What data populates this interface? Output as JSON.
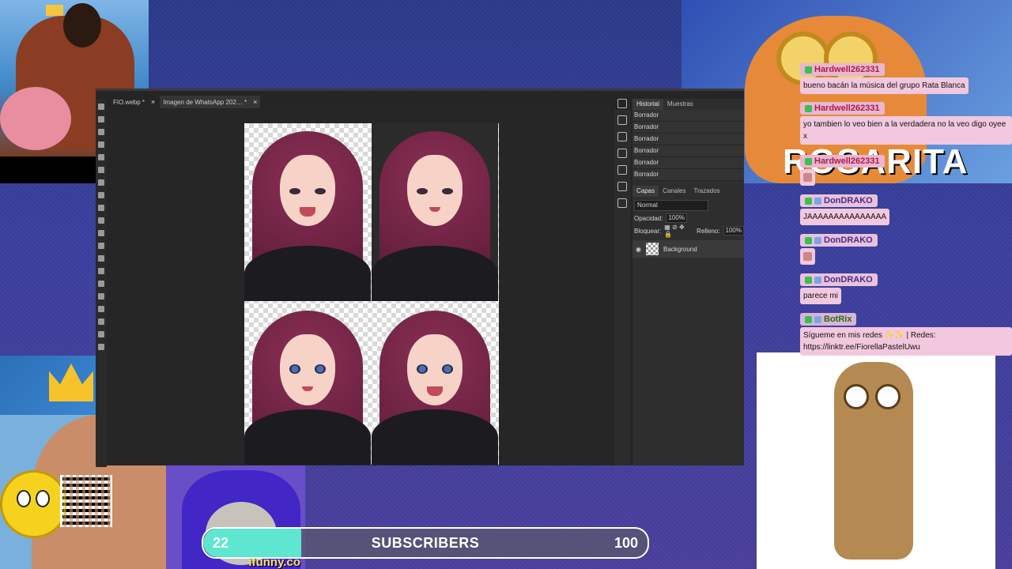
{
  "photoshop": {
    "tabs": [
      {
        "label": "FIO.webp *",
        "close": "×"
      },
      {
        "label": "Imagen de WhatsApp 202… *",
        "close": "×"
      }
    ],
    "panels": {
      "top_tabs": [
        "Historial",
        "Muestras"
      ],
      "history_items": [
        "Borrador",
        "Borrador",
        "Borrador",
        "Borrador",
        "Borrador",
        "Borrador"
      ],
      "layer_tabs": [
        "Capas",
        "Canales",
        "Trazados"
      ],
      "blend_mode": "Normal",
      "opacity_label": "Opacidad:",
      "opacity_value": "100%",
      "lock_label": "Bloquear:",
      "fill_label": "Relleno:",
      "fill_value": "100%",
      "layer_name": "Background"
    }
  },
  "chat": [
    {
      "user": "Hardwell262331",
      "message": "bueno bacán la música del grupo Rata Blanca"
    },
    {
      "user": "Hardwell262331",
      "message": "yo tambien lo veo bien a la verdadera no la veo digo oyee x"
    },
    {
      "user": "Hardwell262331",
      "message": ""
    },
    {
      "user": "DonDRAKO",
      "message": "JAAAAAAAAAAAAAAA"
    },
    {
      "user": "DonDRAKO",
      "message": ""
    },
    {
      "user": "DonDRAKO",
      "message": "parece mi"
    },
    {
      "user": "BotRix",
      "message": "Sígueme en mis redes ✨✨ | Redes: https://linktr.ee/FiorellaPastelUwu"
    }
  ],
  "overlays": {
    "top_right_watermark": "ROSARITA",
    "bottom_watermark": "ifunny.co"
  },
  "subscriber_goal": {
    "current": "22",
    "label": "SUBSCRIBERS",
    "goal": "100",
    "progress": 0.22,
    "fill_color": "#5ee6d0"
  }
}
